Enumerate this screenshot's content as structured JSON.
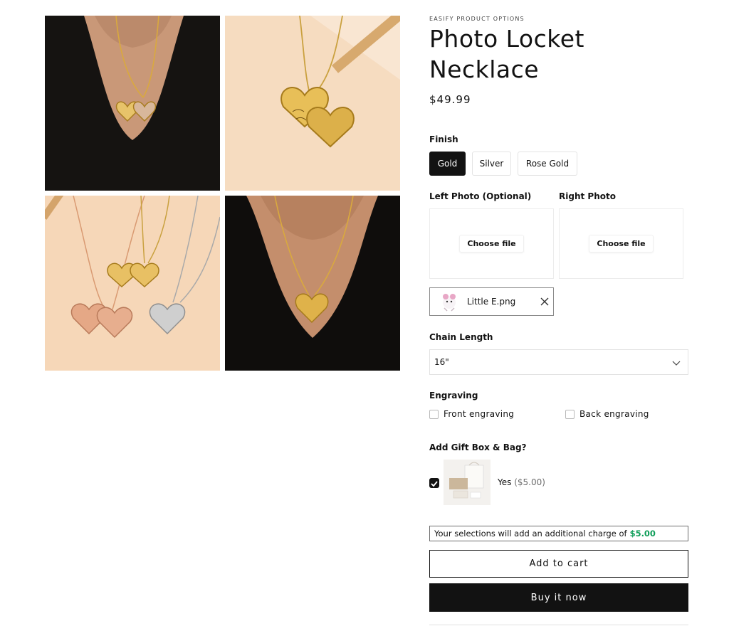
{
  "product": {
    "vendor": "EASIFY PRODUCT OPTIONS",
    "title": "Photo Locket Necklace",
    "price": "$49.99"
  },
  "gallery": {
    "images": [
      {
        "description": "model wearing open gold heart locket"
      },
      {
        "description": "open gold heart locket with engraving on peach background"
      },
      {
        "description": "gold, rose gold and silver lockets on peach background"
      },
      {
        "description": "model wearing closed gold heart locket"
      }
    ]
  },
  "options": {
    "finish": {
      "label": "Finish",
      "choices": [
        "Gold",
        "Silver",
        "Rose Gold"
      ],
      "selected": "Gold"
    },
    "left_photo": {
      "label": "Left Photo (Optional)",
      "button": "Choose file"
    },
    "right_photo": {
      "label": "Right Photo",
      "button": "Choose file"
    },
    "uploaded_file": {
      "name": "Little E.png"
    },
    "chain_length": {
      "label": "Chain Length",
      "value": "16\""
    },
    "engraving": {
      "label": "Engraving",
      "front": "Front engraving",
      "back": "Back engraving"
    },
    "gift": {
      "label": "Add Gift Box & Bag?",
      "option": "Yes",
      "price": "($5.00)",
      "checked": true
    }
  },
  "notice": {
    "text": "Your selections will add an additional charge of",
    "amount": "$5.00",
    "amount_color": "#0d9d58"
  },
  "actions": {
    "add_to_cart": "Add to cart",
    "buy_now": "Buy it now"
  },
  "icons": {
    "remove_file": "close-icon",
    "dropdown": "chevron-down-icon",
    "checkbox_checked": "checkmark-icon"
  }
}
